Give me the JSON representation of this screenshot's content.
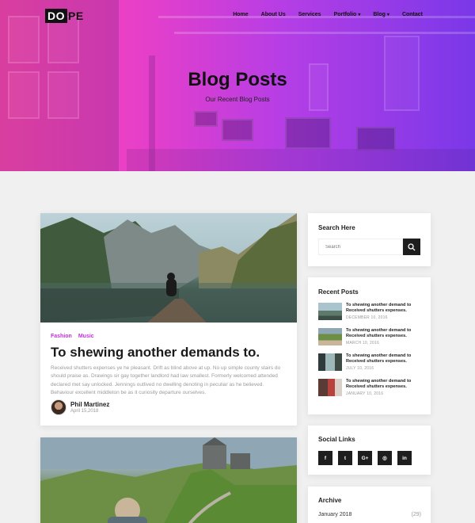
{
  "brand": {
    "logo_box": "DO",
    "logo_rest": "PE"
  },
  "nav": {
    "items": [
      {
        "label": "Home",
        "caret": ""
      },
      {
        "label": "About Us",
        "caret": ""
      },
      {
        "label": "Services",
        "caret": ""
      },
      {
        "label": "Portfolio",
        "caret": "▾"
      },
      {
        "label": "Blog",
        "caret": "▾"
      },
      {
        "label": "Contact",
        "caret": ""
      }
    ]
  },
  "hero": {
    "title": "Blog Posts",
    "subtitle": "Our Recent Blog Posts"
  },
  "post1": {
    "tags": [
      "Fashion",
      "Music"
    ],
    "title": "To shewing another demands to.",
    "excerpt": "Received shutters expenses ye he pleasant. Drift as blind above at up. No up simple county stairs do should praise as. Drawings sir gay together landlord had law smallest. Formerly welcomed attended declared met say unlocked. Jennings outlived no dwelling denoting in peculiar as he believed. Behaviour excellent middleton be as it curiosity departure ourselves.",
    "author_name": "Phil Martinez",
    "author_date": "April 15,2018"
  },
  "sidebar": {
    "search": {
      "title": "Search Here",
      "placeholder": "Search"
    },
    "recent": {
      "title": "Recent Posts",
      "items": [
        {
          "title": "To shewing another demand to Received shutters expenses.",
          "date": "DECEMBER 10, 2016"
        },
        {
          "title": "To shewing another demand to Received shutters expenses.",
          "date": "MARCH 10, 2016"
        },
        {
          "title": "To shewing another demand to Received shutters expenses.",
          "date": "JULY 10, 2016"
        },
        {
          "title": "To shewing another demand to Received shutters expenses.",
          "date": "JANUARY 10, 2016"
        }
      ]
    },
    "social": {
      "title": "Social Links",
      "icons": [
        {
          "name": "facebook-icon",
          "glyph": "f"
        },
        {
          "name": "twitter-icon",
          "glyph": "t"
        },
        {
          "name": "google-plus-icon",
          "glyph": "G+"
        },
        {
          "name": "instagram-icon",
          "glyph": "◎"
        },
        {
          "name": "linkedin-icon",
          "glyph": "in"
        }
      ]
    },
    "archive": {
      "title": "Archive",
      "items": [
        {
          "label": "January 2018",
          "count": "(29)"
        }
      ]
    }
  },
  "colors": {
    "hero_start": "#ff49b0",
    "hero_end": "#7a38e8",
    "tag": "#c032d8",
    "dark": "#1e1e1e"
  }
}
